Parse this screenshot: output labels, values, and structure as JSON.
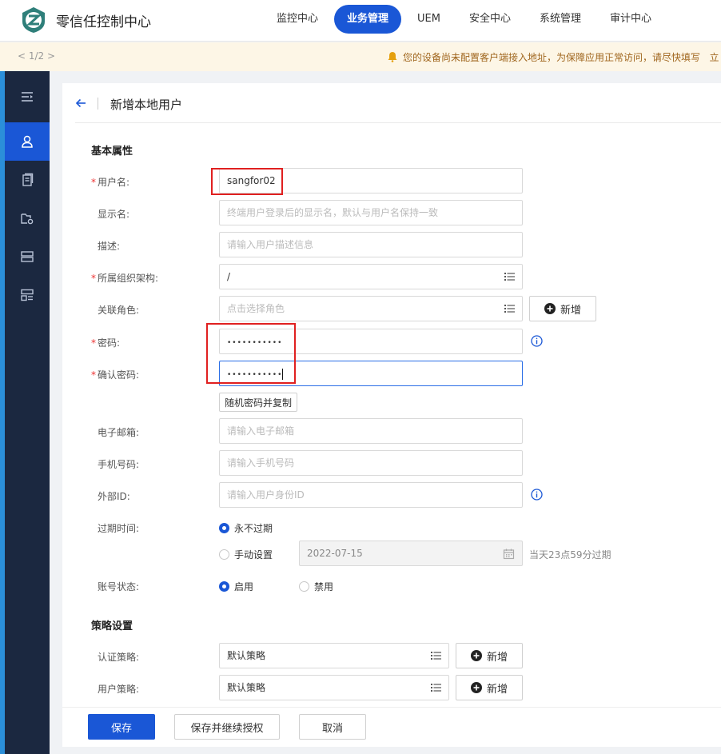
{
  "header": {
    "app_title": "零信任控制中心",
    "nav": [
      {
        "label": "监控中心",
        "active": false
      },
      {
        "label": "业务管理",
        "active": true
      },
      {
        "label": "UEM",
        "active": false
      },
      {
        "label": "安全中心",
        "active": false
      },
      {
        "label": "系统管理",
        "active": false
      },
      {
        "label": "审计中心",
        "active": false
      }
    ]
  },
  "notice": {
    "pager": "< 1/2 >",
    "text": "您的设备尚未配置客户端接入地址，为保障应用正常访问，请尽快填写",
    "trail": "立"
  },
  "page": {
    "title": "新增本地用户"
  },
  "basic": {
    "section_title": "基本属性",
    "username": {
      "label": "用户名:",
      "value": "sangfor02"
    },
    "display_name": {
      "label": "显示名:",
      "placeholder": "终端用户登录后的显示名，默认与用户名保持一致"
    },
    "description": {
      "label": "描述:",
      "placeholder": "请输入用户描述信息"
    },
    "org": {
      "label": "所属组织架构:",
      "value": "/"
    },
    "role": {
      "label": "关联角色:",
      "placeholder": "点击选择角色",
      "add_label": "新增"
    },
    "password": {
      "label": "密码:",
      "value": "•••••••••••"
    },
    "confirm_password": {
      "label": "确认密码:",
      "value": "•••••••••••"
    },
    "random_pwd_label": "随机密码并复制",
    "email": {
      "label": "电子邮箱:",
      "placeholder": "请输入电子邮箱"
    },
    "phone": {
      "label": "手机号码:",
      "placeholder": "请输入手机号码"
    },
    "external_id": {
      "label": "外部ID:",
      "placeholder": "请输入用户身份ID"
    },
    "expire": {
      "label": "过期时间:",
      "never": "永不过期",
      "manual": "手动设置",
      "date": "2022-07-15",
      "hint": "当天23点59分过期"
    },
    "status": {
      "label": "账号状态:",
      "enabled": "启用",
      "disabled": "禁用"
    }
  },
  "policy": {
    "section_title": "策略设置",
    "auth": {
      "label": "认证策略:",
      "value": "默认策略",
      "add_label": "新增"
    },
    "user": {
      "label": "用户策略:",
      "value": "默认策略",
      "add_label": "新增"
    }
  },
  "footer": {
    "save": "保存",
    "save_continue": "保存并继续授权",
    "cancel": "取消"
  },
  "colors": {
    "primary": "#1a57d6",
    "sidebar": "#1b2840",
    "required": "#e33333",
    "highlight_box": "#e02020"
  }
}
